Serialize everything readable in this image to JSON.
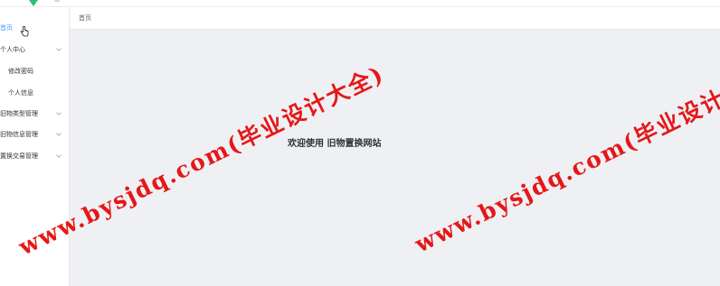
{
  "sidebar": {
    "items": [
      {
        "label": "首页",
        "active": true
      },
      {
        "label": "个人中心",
        "expandable": true
      },
      {
        "label": "修改密码",
        "sub": true
      },
      {
        "label": "个人信息",
        "sub": true
      },
      {
        "label": "旧物类型管理",
        "expandable": true
      },
      {
        "label": "旧物信息管理",
        "expandable": true
      },
      {
        "label": "置换交易管理",
        "expandable": true
      }
    ]
  },
  "breadcrumb": {
    "label": "首页"
  },
  "main": {
    "welcome": "欢迎使用 旧物置换网站"
  },
  "watermark": {
    "text": "www.bysjdq.com(毕业设计大全)"
  },
  "colors": {
    "active": "#409eff",
    "watermark": "#e60000",
    "content_bg": "#eff0f4"
  }
}
